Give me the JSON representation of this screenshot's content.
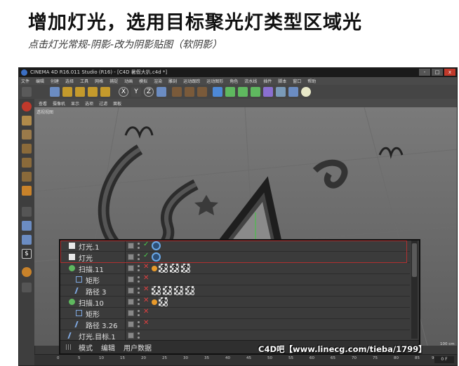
{
  "header": {
    "title": "增加灯光，选用目标聚光灯类型区域光",
    "subtitle": "点击灯光常规-阴影-改为阴影贴图（软阴影）"
  },
  "window": {
    "title": "CINEMA 4D R16.011 Studio (R16) - [C4D 暑假大扒.c4d *]",
    "controls": [
      "-",
      "□",
      "x"
    ]
  },
  "menubar": [
    "文件",
    "编辑",
    "创建",
    "选择",
    "工具",
    "网格",
    "捕捉",
    "动画",
    "模拟",
    "渲染",
    "雕刻",
    "运动跟踪",
    "运动图形",
    "角色",
    "流水线",
    "插件",
    "脚本",
    "窗口",
    "帮助"
  ],
  "viewport": {
    "menu": [
      "查看",
      "摄像机",
      "显示",
      "选项",
      "过滤",
      "面板"
    ],
    "label": "透视视图"
  },
  "toolbar_letters": [
    "X",
    "Y",
    "Z"
  ],
  "object_manager": {
    "rows": [
      {
        "name": "灯光.1",
        "indent": 0,
        "check": "✓",
        "check_color": "#4ec94e",
        "tags": [
          "target"
        ]
      },
      {
        "name": "灯光",
        "indent": 0,
        "check": "✓",
        "check_color": "#4ec94e",
        "tags": [
          "target"
        ]
      },
      {
        "name": "扫描.11",
        "indent": 0,
        "check": "✕",
        "check_color": "#e04040",
        "tags": [
          "orange",
          "checker",
          "checker",
          "checker"
        ]
      },
      {
        "name": "矩形",
        "indent": 1,
        "check": "✕",
        "check_color": "#e04040",
        "tags": []
      },
      {
        "name": "路径 3",
        "indent": 1,
        "check": "✕",
        "check_color": "#e04040",
        "tags": [
          "checker",
          "checker",
          "checker",
          "checker"
        ]
      },
      {
        "name": "扫描.10",
        "indent": 0,
        "check": "✕",
        "check_color": "#e04040",
        "tags": [
          "orange",
          "checker"
        ]
      },
      {
        "name": "矩形",
        "indent": 1,
        "check": "✕",
        "check_color": "#e04040",
        "tags": []
      },
      {
        "name": "路径 3.26",
        "indent": 1,
        "check": "✕",
        "check_color": "#e04040",
        "tags": []
      },
      {
        "name": "灯光.目标.1",
        "indent": 0,
        "check": "",
        "check_color": "#e04040",
        "tags": []
      }
    ],
    "tabs": [
      "模式",
      "编辑",
      "用户数据"
    ]
  },
  "timeline": {
    "ticks": [
      "0",
      "5",
      "10",
      "15",
      "20",
      "25",
      "30",
      "35",
      "40",
      "45",
      "50",
      "55",
      "60",
      "65",
      "70",
      "75",
      "80",
      "85",
      "90"
    ],
    "frame": "0 F",
    "unit": "100 cm"
  },
  "watermark": "C4D吧【www.linecg.com/tieba/1799】",
  "colors": {
    "accent_red": "#b03030",
    "ok_green": "#4ec94e",
    "off_red": "#e04040"
  }
}
